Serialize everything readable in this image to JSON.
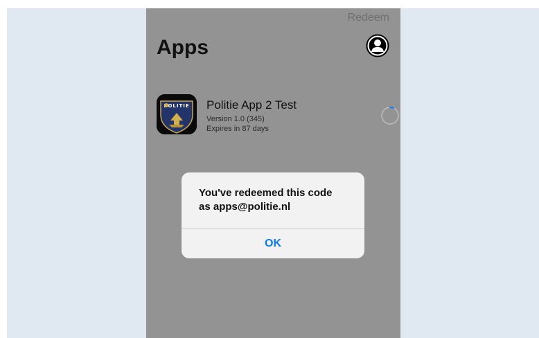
{
  "header": {
    "redeem_label": "Redeem",
    "title": "Apps",
    "profile_icon": "person-circle-icon"
  },
  "apps": [
    {
      "name": "Politie App 2 Test",
      "version": "Version 1.0 (345)",
      "expires": "Expires in 87 days",
      "icon": "politie-logo-icon",
      "icon_text": "POLITIE",
      "status_icon": "loading-spinner-icon"
    }
  ],
  "alert": {
    "message_line1": "You've redeemed this code",
    "message_prefix": "as ",
    "email": "apps@politie.nl",
    "ok_label": "OK"
  },
  "colors": {
    "page_background": "#e0e9f1",
    "dimmed_background": "#939393",
    "alert_background": "#f2f2f2",
    "accent": "#0a7aff"
  }
}
